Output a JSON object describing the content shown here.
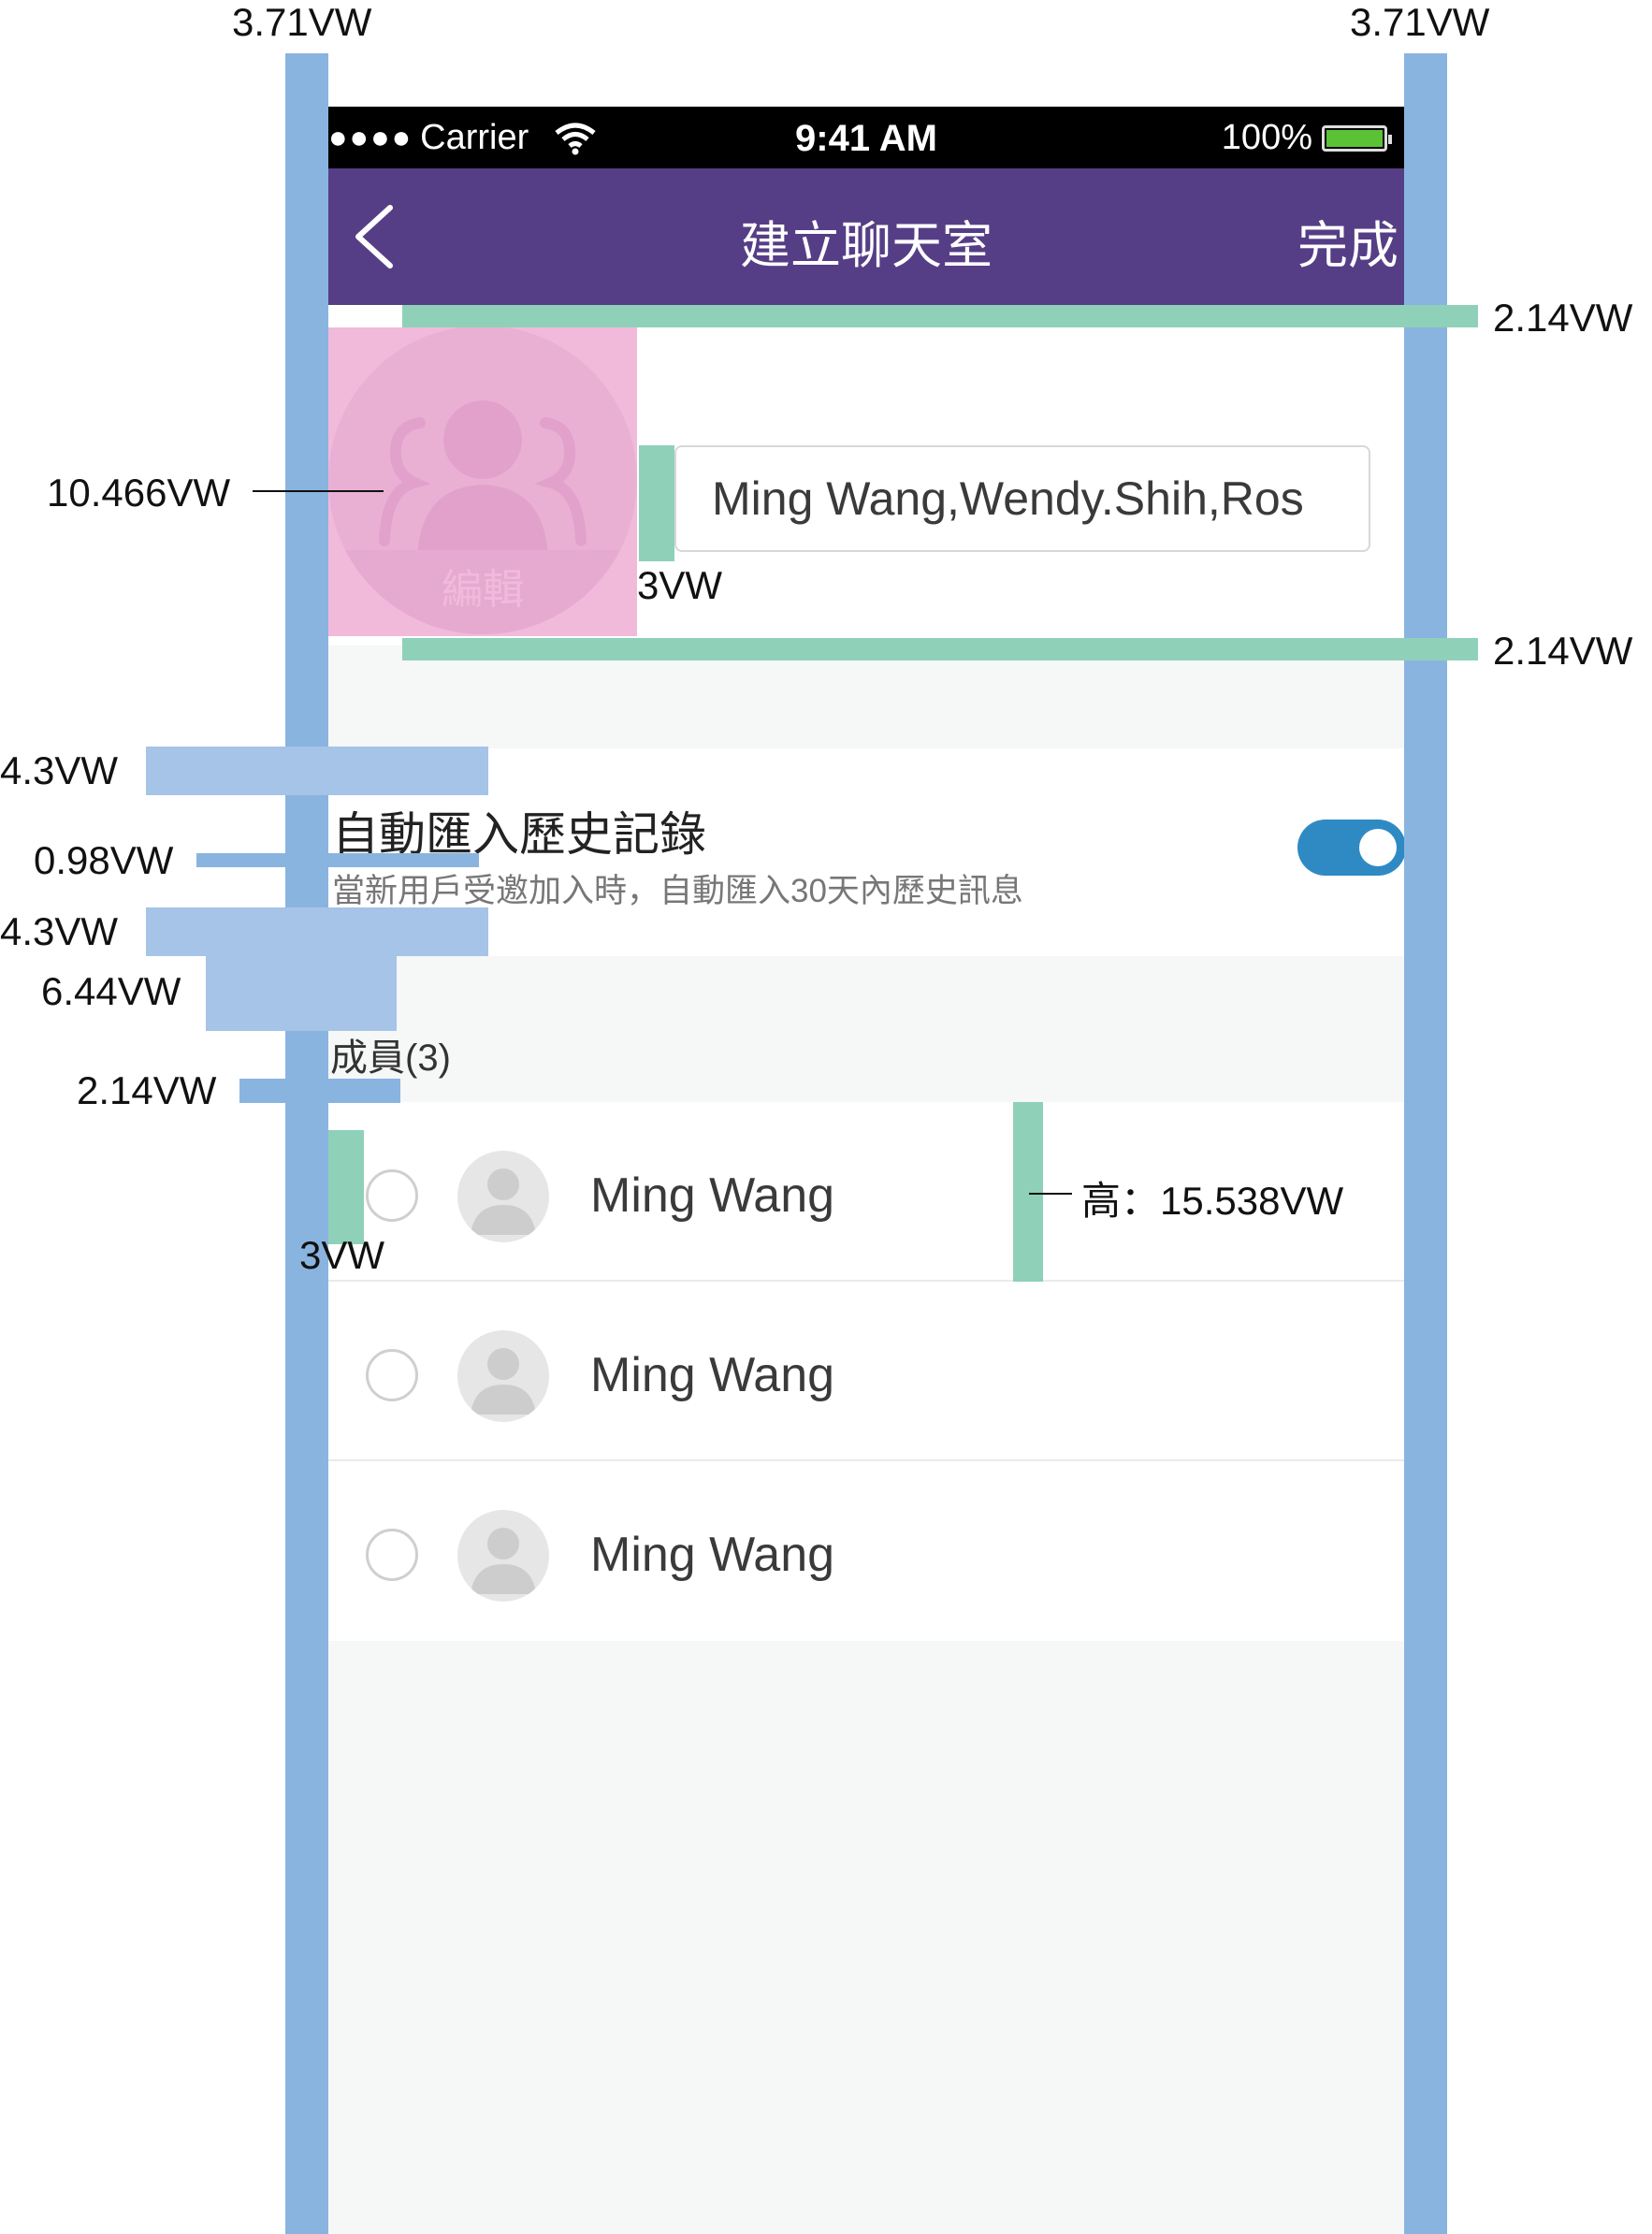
{
  "status_bar": {
    "signal": "●●●●",
    "carrier": "Carrier",
    "time": "9:41 AM",
    "battery_percent": "100%"
  },
  "nav": {
    "title": "建立聊天室",
    "done_label": "完成"
  },
  "group": {
    "avatar_caption": "編輯",
    "name_value": "Ming Wang,Wendy.Shih,Ros"
  },
  "history": {
    "title": "自動匯入歷史記錄",
    "description": "當新用戶受邀加入時，自動匯入30天內歷史訊息",
    "enabled": true
  },
  "members": {
    "label": "成員(3)",
    "items": [
      {
        "name": "Ming Wang",
        "selected": false
      },
      {
        "name": "Ming Wang",
        "selected": false
      },
      {
        "name": "Ming Wang",
        "selected": false
      }
    ]
  },
  "annotations": {
    "left_margin": "3.71VW",
    "right_margin": "3.71VW",
    "header_top_gap": "2.14VW",
    "header_bottom_gap": "2.14VW",
    "avatar_size": "10.466VW",
    "avatar_field_gap": "3VW",
    "history_top_pad": "4.3VW",
    "history_line_gap": "0.98VW",
    "history_bottom_pad": "4.3VW",
    "members_label_top": "6.44VW",
    "members_label_bottom": "2.14VW",
    "radio_left_gap": "3VW",
    "row_height": "高：15.538VW"
  },
  "colors": {
    "nav_bg": "#563e86",
    "toggle_on": "#2f8ac4",
    "guide_blue": "#8ab4e0",
    "guide_green": "#8fd1b8",
    "avatar_highlight": "#eba0cd"
  },
  "icons": {
    "back": "chevron-left-icon",
    "wifi": "wifi-icon",
    "battery": "battery-icon",
    "group_avatar": "group-icon",
    "member_avatar": "person-icon",
    "radio": "radio-unchecked-icon"
  }
}
